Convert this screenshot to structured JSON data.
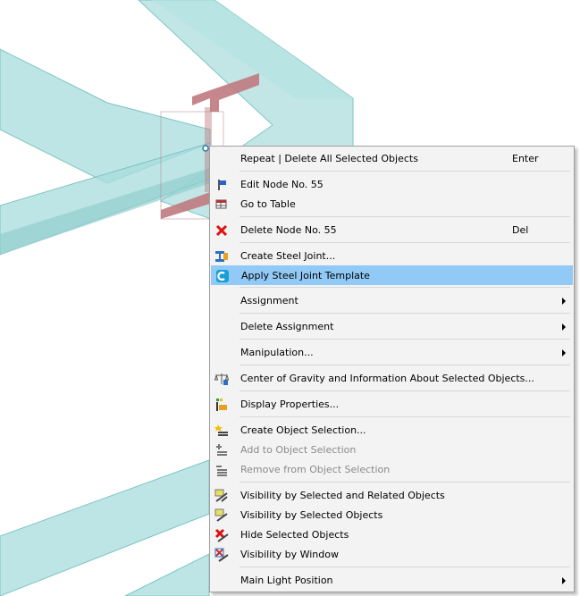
{
  "menu": {
    "items": [
      {
        "label": "Repeat | Delete All Selected Objects",
        "shortcut": "Enter"
      },
      {
        "label": "Edit Node No. 55"
      },
      {
        "label": "Go to Table"
      },
      {
        "label": "Delete Node No. 55",
        "shortcut": "Del"
      },
      {
        "label": "Create Steel Joint..."
      },
      {
        "label": "Apply Steel Joint Template"
      },
      {
        "label": "Assignment"
      },
      {
        "label": "Delete Assignment"
      },
      {
        "label": "Manipulation..."
      },
      {
        "label": "Center of Gravity and Information About Selected Objects..."
      },
      {
        "label": "Display Properties..."
      },
      {
        "label": "Create Object Selection..."
      },
      {
        "label": "Add to Object Selection"
      },
      {
        "label": "Remove from Object Selection"
      },
      {
        "label": "Visibility by Selected and Related Objects"
      },
      {
        "label": "Visibility by Selected Objects"
      },
      {
        "label": "Hide Selected Objects"
      },
      {
        "label": "Visibility by Window"
      },
      {
        "label": "Main Light Position"
      }
    ]
  },
  "colors": {
    "beam": "#a8dcdc",
    "beam_edge": "#7cc4c4",
    "section": "#c07a80",
    "highlight": "#91c9f7",
    "arrow": "#2233cc"
  }
}
